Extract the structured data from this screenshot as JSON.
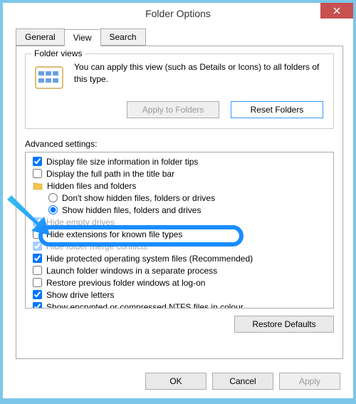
{
  "window": {
    "title": "Folder Options"
  },
  "tabs": {
    "general": "General",
    "view": "View",
    "search": "Search"
  },
  "folder_views": {
    "title": "Folder views",
    "text": "You can apply this view (such as Details or Icons) to all folders of this type.",
    "apply_btn": "Apply to Folders",
    "reset_btn": "Reset Folders"
  },
  "advanced": {
    "label": "Advanced settings:",
    "items": [
      {
        "type": "checkbox",
        "checked": true,
        "label": "Display file size information in folder tips"
      },
      {
        "type": "checkbox",
        "checked": false,
        "label": "Display the full path in the title bar"
      },
      {
        "type": "folder",
        "label": "Hidden files and folders"
      },
      {
        "type": "radio",
        "checked": false,
        "label": "Don't show hidden files, folders or drives",
        "indent": true
      },
      {
        "type": "radio",
        "checked": true,
        "label": "Show hidden files, folders and drives",
        "indent": true
      },
      {
        "type": "checkbox",
        "checked": true,
        "label": "Hide empty drives",
        "obscured": true
      },
      {
        "type": "checkbox",
        "checked": false,
        "label": "Hide extensions for known file types",
        "highlighted": true
      },
      {
        "type": "checkbox",
        "checked": true,
        "label": "Hide folder merge conflicts",
        "obscured": true
      },
      {
        "type": "checkbox",
        "checked": true,
        "label": "Hide protected operating system files (Recommended)"
      },
      {
        "type": "checkbox",
        "checked": false,
        "label": "Launch folder windows in a separate process"
      },
      {
        "type": "checkbox",
        "checked": false,
        "label": "Restore previous folder windows at log-on"
      },
      {
        "type": "checkbox",
        "checked": true,
        "label": "Show drive letters"
      },
      {
        "type": "checkbox",
        "checked": true,
        "label": "Show encrypted or compressed NTFS files in colour"
      }
    ],
    "restore_btn": "Restore Defaults"
  },
  "dialog": {
    "ok": "OK",
    "cancel": "Cancel",
    "apply": "Apply"
  }
}
